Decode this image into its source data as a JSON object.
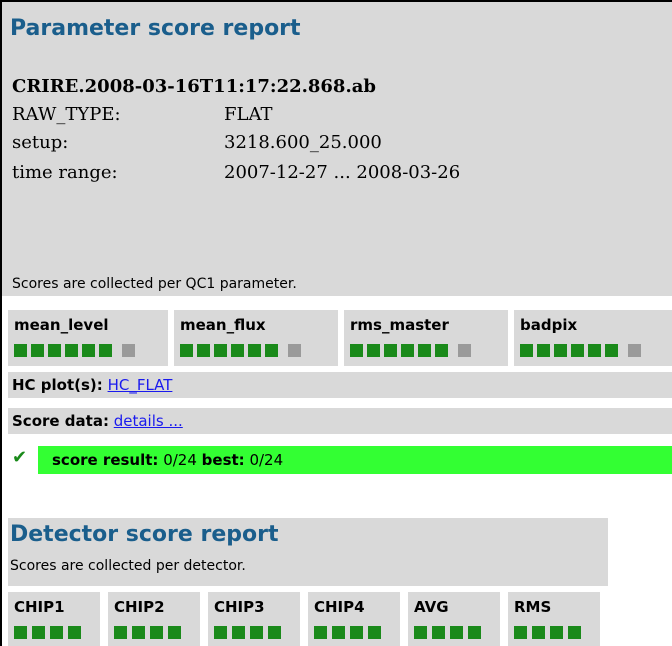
{
  "parameter_report": {
    "title": "Parameter score report",
    "id": "CRIRE.2008-03-16T11:17:22.868.ab",
    "fields": [
      {
        "key": "RAW_TYPE:",
        "value": "FLAT"
      },
      {
        "key": "setup:",
        "value": "3218.600_25.000"
      },
      {
        "key": "time range:",
        "value": "2007-12-27 ... 2008-03-26"
      }
    ],
    "note": "Scores are collected per QC1 parameter.",
    "parameters": [
      {
        "label": "mean_level",
        "green": 6,
        "gray": 1
      },
      {
        "label": "mean_flux",
        "green": 6,
        "gray": 1
      },
      {
        "label": "rms_master",
        "green": 6,
        "gray": 1
      },
      {
        "label": "badpix",
        "green": 6,
        "gray": 1
      }
    ],
    "hc_label": "HC plot(s):",
    "hc_link": "HC_FLAT",
    "score_label": "Score data:",
    "score_link": "details ...",
    "result_label": "score result:",
    "result_value": "0/24",
    "best_label": "best:",
    "best_value": "0/24",
    "colors": {
      "title": "#1a5e8c",
      "panel": "#d9d9d9",
      "ok": "#1a8a1a",
      "result_bg": "#33ff33",
      "link": "#1a1aee"
    }
  },
  "detector_report": {
    "title": "Detector score report",
    "note": "Scores are collected per detector.",
    "detectors": [
      {
        "label": "CHIP1",
        "green": 4
      },
      {
        "label": "CHIP2",
        "green": 4
      },
      {
        "label": "CHIP3",
        "green": 4
      },
      {
        "label": "CHIP4",
        "green": 4
      },
      {
        "label": "AVG",
        "green": 4
      },
      {
        "label": "RMS",
        "green": 4
      }
    ]
  }
}
